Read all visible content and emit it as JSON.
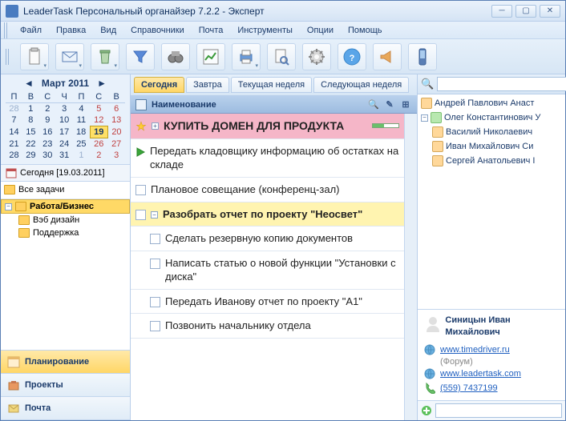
{
  "window": {
    "title": "LeaderTask Персональный органайзер 7.2.2 - Эксперт"
  },
  "menu": {
    "file": "Файл",
    "edit": "Правка",
    "view": "Вид",
    "ref": "Справочники",
    "mail": "Почта",
    "tools": "Инструменты",
    "opt": "Опции",
    "help": "Помощь"
  },
  "calendar": {
    "title": "Март 2011",
    "dow": [
      "П",
      "В",
      "С",
      "Ч",
      "П",
      "С",
      "В"
    ],
    "today_label": "Сегодня [19.03.2011]"
  },
  "tree": {
    "all": "Все задачи",
    "work": "Работа/Бизнес",
    "web": "Вэб дизайн",
    "support": "Поддержка"
  },
  "nav": {
    "plan": "Планирование",
    "proj": "Проекты",
    "mail": "Почта"
  },
  "tabs": {
    "today": "Сегодня",
    "tomorrow": "Завтра",
    "week": "Текущая неделя",
    "nextweek": "Следующая неделя"
  },
  "list": {
    "header": "Наименование",
    "t1": "КУПИТЬ ДОМЕН ДЛЯ ПРОДУКТА",
    "t2": "Передать кладовщику информацию об остатках на складе",
    "t3": "Плановое совещание (конференц-зал)",
    "t4": "Разобрать отчет по проекту \"Неосвет\"",
    "t5": "Сделать резервную копию документов",
    "t6": "Написать статью о новой функции \"Установки с диска\"",
    "t7": "Передать Иванову отчет по проекту \"А1\"",
    "t8": "Позвонить начальнику отдела"
  },
  "search": {
    "placeholder": ""
  },
  "contacts": {
    "c1": "Андрей Павлович Анаст",
    "c2": "Олег Константинович У",
    "c3": "Василий Николаевич ",
    "c4": "Иван Михайлович Си",
    "c5": "Сергей Анатольевич I"
  },
  "detail": {
    "name": "Синицын Иван Михайлович",
    "url1": "www.timedriver.ru",
    "url1sub": "(Форум)",
    "url2": "www.leadertask.com",
    "phone": "(559) 7437199"
  }
}
